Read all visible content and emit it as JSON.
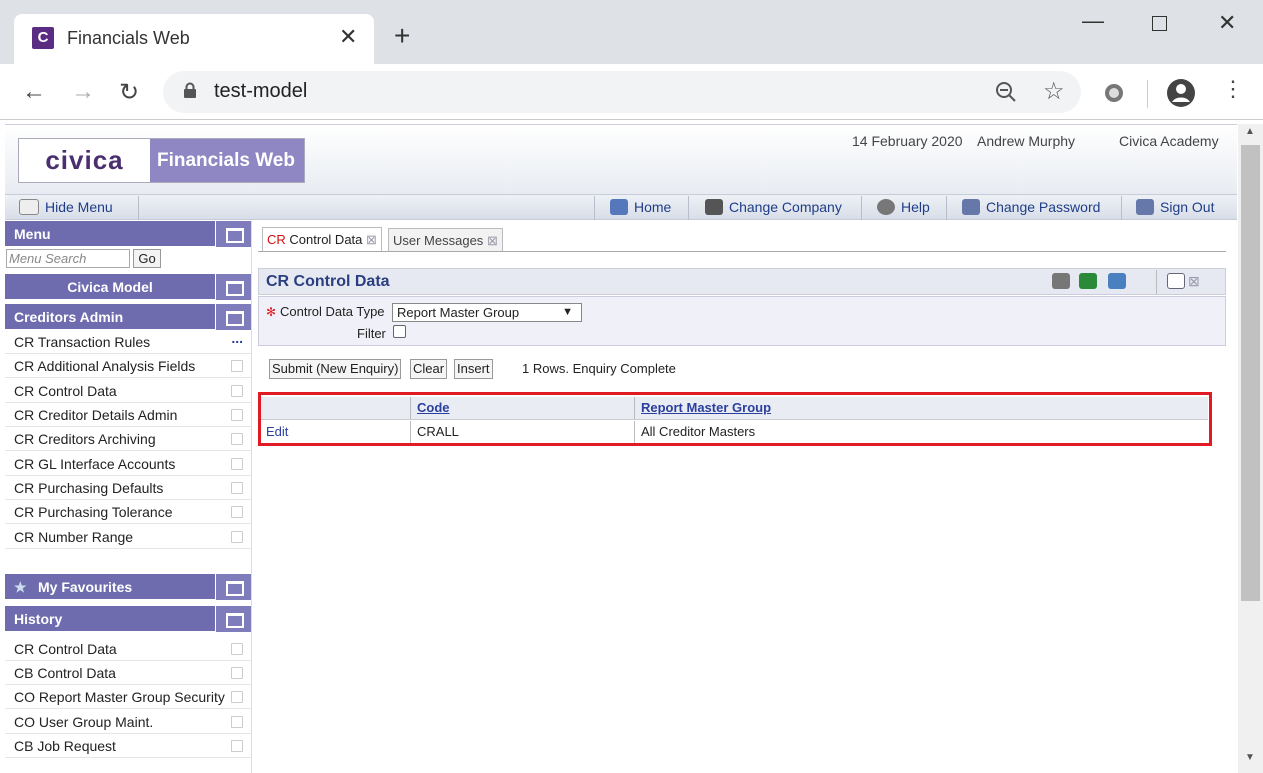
{
  "browser": {
    "tab_title": "Financials Web",
    "url": "test-model"
  },
  "header": {
    "logo_left": "civica",
    "logo_right": "Financials Web",
    "date": "14 February 2020",
    "user": "Andrew Murphy",
    "org": "Civica Academy"
  },
  "menubar": {
    "hide_menu": "Hide Menu",
    "home": "Home",
    "change_company": "Change Company",
    "help": "Help",
    "change_password": "Change Password",
    "sign_out": "Sign Out"
  },
  "sidebar": {
    "menu_title": "Menu",
    "search_placeholder": "Menu Search",
    "go": "Go",
    "model_title": "Civica Model",
    "section_title": "Creditors Admin",
    "items": [
      "CR Transaction Rules",
      "CR Additional Analysis Fields",
      "CR Control Data",
      "CR Creditor Details Admin",
      "CR Creditors Archiving",
      "CR GL Interface Accounts",
      "CR Purchasing Defaults",
      "CR Purchasing Tolerance",
      "CR Number Range"
    ],
    "favourites_title": "My Favourites",
    "history_title": "History",
    "history": [
      "CR Control Data",
      "CB Control Data",
      "CO Report Master Group Security",
      "CO User Group Maint.",
      "CB Job Request"
    ]
  },
  "main": {
    "tab1_prefix": "CR",
    "tab1_label": "Control Data",
    "tab2_label": "User Messages",
    "title": "CR Control Data",
    "control_label": "Control Data Type",
    "control_value": "Report Master Group",
    "filter_label": "Filter",
    "submit": "Submit (New Enquiry)",
    "clear": "Clear",
    "insert": "Insert",
    "status": "1 Rows. Enquiry Complete",
    "grid": {
      "headers": [
        "",
        "Code",
        "Report Master Group"
      ],
      "rows": [
        [
          "Edit",
          "CRALL",
          "All Creditor Masters"
        ]
      ]
    }
  },
  "colors": {
    "accent": "#6e6cae",
    "highlight": "#e01b24",
    "link": "#2a3f9f"
  }
}
